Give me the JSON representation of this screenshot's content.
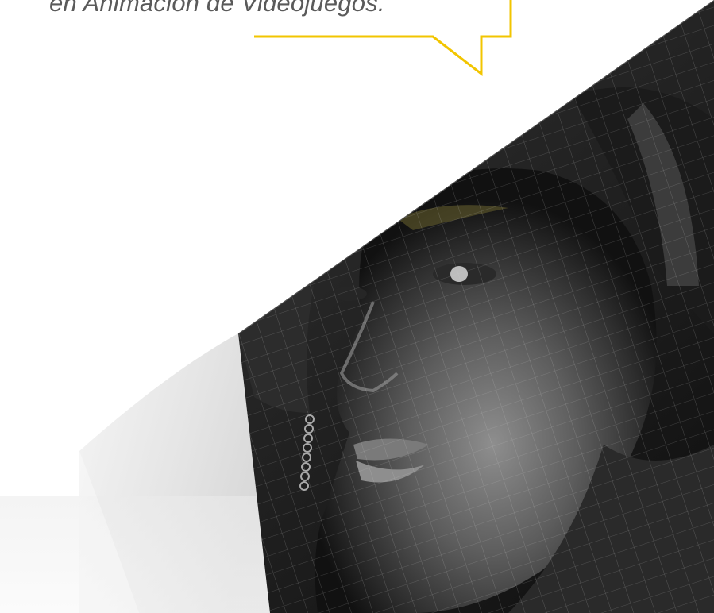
{
  "quote": {
    "text": "en Animación de Videojuegos."
  },
  "colors": {
    "accent": "#f2c500",
    "text": "#5a5a5a",
    "background": "#ffffff"
  },
  "hero_image": {
    "icon": "wireframe-face-render"
  }
}
